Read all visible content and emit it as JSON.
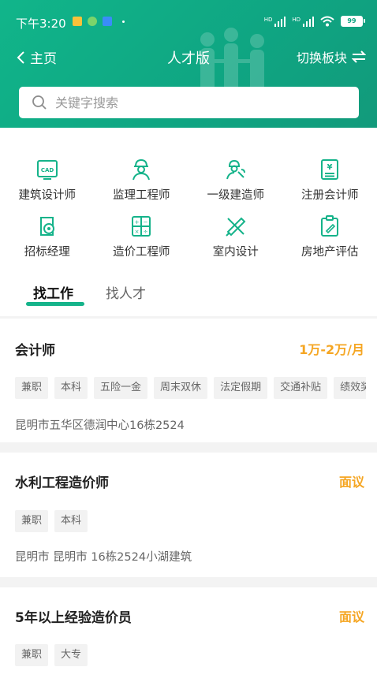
{
  "status_bar": {
    "time": "下午3:20",
    "battery": "99"
  },
  "nav": {
    "back_label": "主页",
    "title": "人才版",
    "switch_label": "切换板块"
  },
  "search": {
    "placeholder": "关键字搜索",
    "value": ""
  },
  "categories": [
    {
      "label": "建筑设计师",
      "icon": "cad-icon"
    },
    {
      "label": "监理工程师",
      "icon": "engineer-icon"
    },
    {
      "label": "一级建造师",
      "icon": "builder-icon"
    },
    {
      "label": "注册会计师",
      "icon": "accountant-icon"
    },
    {
      "label": "招标经理",
      "icon": "bidding-icon"
    },
    {
      "label": "造价工程师",
      "icon": "calculator-icon"
    },
    {
      "label": "室内设计",
      "icon": "design-tools-icon"
    },
    {
      "label": "房地产评估",
      "icon": "clipboard-icon"
    }
  ],
  "tabs": [
    {
      "label": "找工作",
      "active": true
    },
    {
      "label": "找人才",
      "active": false
    }
  ],
  "jobs": [
    {
      "title": "会计师",
      "salary": "1万-2万/月",
      "tags": [
        "兼职",
        "本科",
        "五险一金",
        "周末双休",
        "法定假期",
        "交通补贴",
        "绩效奖金"
      ],
      "address": "昆明市五华区德润中心16栋2524"
    },
    {
      "title": "水利工程造价师",
      "salary": "面议",
      "tags": [
        "兼职",
        "本科"
      ],
      "address": "昆明市 昆明市 16栋2524小湖建筑"
    },
    {
      "title": "5年以上经验造价员",
      "salary": "面议",
      "tags": [
        "兼职",
        "大专"
      ],
      "address": ""
    }
  ],
  "colors": {
    "brand": "#11b58a",
    "salary": "#f5a623",
    "tab_underline": "#15b38a"
  }
}
